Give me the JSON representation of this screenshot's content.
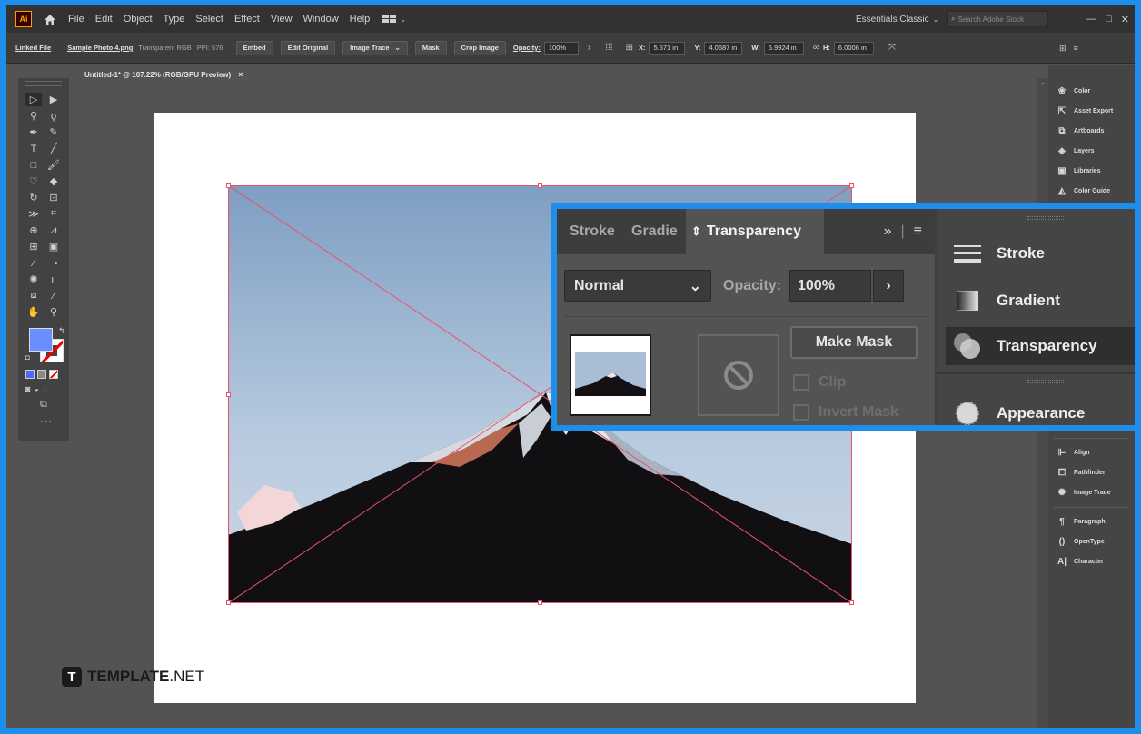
{
  "menubar": {
    "logo": "Ai",
    "items": [
      "File",
      "Edit",
      "Object",
      "Type",
      "Select",
      "Effect",
      "View",
      "Window",
      "Help"
    ],
    "workspace": "Essentials Classic",
    "search_placeholder": "Search Adobe Stock",
    "window_controls": [
      "—",
      "□",
      "✕"
    ]
  },
  "controlbar": {
    "linked_file": "Linked File",
    "file_name": "Sample Photo 4.png",
    "file_meta": "Transparent RGB",
    "ppi": "PPI: 576",
    "embed": "Embed",
    "edit_original": "Edit Original",
    "image_trace": "Image Trace",
    "mask": "Mask",
    "crop_image": "Crop Image",
    "opacity_label": "Opacity:",
    "opacity_value": "100%",
    "x_label": "X:",
    "x_value": "5.571 in",
    "y_label": "Y:",
    "y_value": "4.0687 in",
    "w_label": "W:",
    "w_value": "5.9924 in",
    "h_label": "H:",
    "h_value": "6.0006 in"
  },
  "doc_tab": {
    "title": "Untitled-1* @ 107.22% (RGB/GPU Preview)",
    "close": "×"
  },
  "dock": {
    "items": [
      "Color",
      "Asset Export",
      "Artboards",
      "Layers",
      "Libraries",
      "Color Guide",
      "Align",
      "Pathfinder",
      "Image Trace",
      "Paragraph",
      "OpenType",
      "Character"
    ]
  },
  "transparency_panel": {
    "tabs": [
      "Stroke",
      "Gradie",
      "Transparency"
    ],
    "blend_mode": "Normal",
    "opacity_label": "Opacity:",
    "opacity_value": "100%",
    "make_mask": "Make Mask",
    "clip": "Clip",
    "invert_mask": "Invert Mask"
  },
  "side_panel": {
    "items": [
      "Stroke",
      "Gradient",
      "Transparency",
      "Appearance"
    ]
  },
  "watermark": {
    "brand": "TEMPLATE",
    "suffix": ".NET",
    "logo_letter": "T"
  },
  "colors": {
    "accent": "#1d8ee9",
    "fill_swatch": "#6a8dff",
    "selection": "#e8536a"
  }
}
